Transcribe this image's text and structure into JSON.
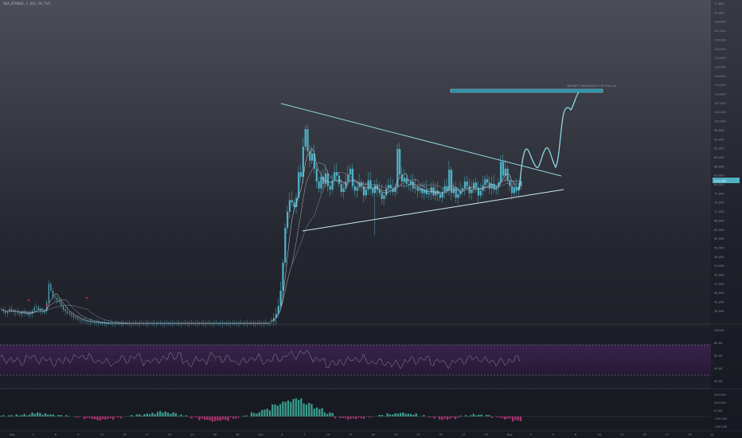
{
  "symbol": "SEA_STANDE, 1, KSC, FK, TV1",
  "target_label": "TARGET: 138,000.00 (+37.7%) n/a",
  "colors": {
    "background_top": "#4b4e57",
    "background_bottom": "#131722",
    "candle": "#4fb0c6",
    "trendline": "#8fd6e3",
    "target_box": "#2a8fa6",
    "rsi_line": "#9a9fa8",
    "rsi_band": "#5a3b78",
    "hist_up": "#3b9c8d",
    "hist_down": "#a8336e",
    "marker": "#c2185b"
  },
  "price_axis": [
    "77,800",
    "72,000",
    "136,000",
    "131,000",
    "128,000",
    "125,000",
    "122,000",
    "119,000",
    "116,000",
    "113,000",
    "110,000",
    "107,000",
    "104,000",
    "101,000",
    "98,000",
    "95,000",
    "92,000",
    "89,000",
    "86,000",
    "83,000",
    "80,000",
    "77,000",
    "74,000",
    "71,000",
    "68,000",
    "65,000",
    "62,000",
    "59,000",
    "56,000",
    "53,000",
    "50,000",
    "47,000",
    "44,000",
    "41,000",
    "38,000"
  ],
  "current_price": "101,000",
  "rsi_axis": [
    "100.00",
    "80.00",
    "60.00",
    "40.00",
    "20.00"
  ],
  "macd_axis": [
    "350.000",
    "200.000",
    "0.000",
    "-200.000",
    "-350.000"
  ],
  "time_axis": [
    "Sep",
    "3",
    "6",
    "9",
    "12",
    "15",
    "17",
    "20",
    "23",
    "26",
    "28",
    "Oct",
    "4",
    "7",
    "10",
    "13",
    "16",
    "19",
    "22",
    "25",
    "27",
    "29",
    "Nov",
    "3",
    "5",
    "8",
    "10",
    "12",
    "15",
    "17",
    "19",
    "21"
  ],
  "chart_data": {
    "type": "candlestick",
    "title": "",
    "xlabel": "",
    "ylabel": "",
    "x_range": [
      0,
      130
    ],
    "ylim": [
      38000,
      138000
    ],
    "grid": false,
    "legend": "none",
    "close": [
      44000,
      43200,
      42400,
      42900,
      44200,
      43600,
      42800,
      43100,
      42300,
      41800,
      42500,
      43000,
      42200,
      41600,
      42100,
      43400,
      44800,
      45100,
      44000,
      43200,
      42700,
      43300,
      47000,
      55000,
      52000,
      49500,
      49000,
      48000,
      47200,
      45500,
      44000,
      43200,
      42500,
      42000,
      41400,
      40800,
      40300,
      39800,
      39600,
      39300,
      39000,
      38800,
      38700,
      38600,
      38500,
      38400,
      38300,
      38200,
      38100,
      38000,
      38000,
      38000,
      38000,
      38000,
      38000,
      38000,
      38000,
      38000,
      38000,
      38000,
      38000,
      38000,
      38000,
      38000,
      38000,
      38000,
      38000,
      38000,
      38000,
      38000,
      38000,
      38000,
      38000,
      38000,
      38000,
      38000,
      38000,
      38000,
      38000,
      38000,
      38000,
      38000,
      38000,
      38000,
      38000,
      38000,
      38000,
      38000,
      38000,
      38000,
      38000,
      38000,
      38000,
      38000,
      38000,
      38000,
      38000,
      38000,
      38000,
      38000,
      38000,
      38000,
      38000,
      38000,
      38000,
      38000,
      38000,
      38000,
      38000,
      38000,
      38000,
      38000,
      38000,
      38000,
      38000,
      38000,
      38000,
      38000,
      38000,
      38000,
      38000,
      38000,
      38000,
      38000,
      38000,
      38000,
      38000,
      38000,
      38000,
      38000,
      38000
    ],
    "post_gap_close": [
      39000,
      40200,
      42000,
      45500,
      52000,
      64000,
      79000,
      86000,
      91000,
      90000,
      88000,
      92000,
      103000,
      101000,
      114000,
      121500,
      112000,
      108000,
      111000,
      104500,
      99000,
      96000,
      101000,
      98000,
      102500,
      97000,
      95500,
      99500,
      103000,
      101500,
      98000,
      94500,
      96000,
      99000,
      102000,
      104500,
      97000,
      95000,
      96500,
      98500,
      97000,
      93000,
      95500,
      99500,
      96000,
      94000,
      97500,
      95500,
      94000,
      91500,
      93000,
      96000,
      97500,
      96000,
      94500,
      96500,
      113000,
      102000,
      99000,
      100500,
      98000,
      97500,
      99000,
      96000,
      96500,
      95000,
      96000,
      94000,
      95500,
      93500,
      94000,
      96500,
      93000,
      95000,
      93500,
      92000,
      94500,
      97000,
      95000,
      104000,
      94000,
      96500,
      92000,
      93500,
      95000,
      96000,
      99000,
      97000,
      94000,
      95500,
      98500,
      96500,
      93000,
      95000,
      97500,
      100000,
      98500,
      96000,
      98000,
      95500,
      96500,
      98500,
      107500,
      101500,
      104500,
      99500,
      97000,
      94000,
      96500,
      95000,
      97000,
      99000
    ],
    "rsi": [
      52,
      48,
      55,
      50,
      46,
      53,
      58,
      49,
      44,
      51,
      56,
      47,
      53,
      60,
      45,
      50,
      57,
      52,
      46,
      54,
      49,
      55,
      61,
      64,
      50,
      42,
      48,
      53,
      47,
      45,
      41,
      49,
      52,
      47,
      43,
      50,
      54,
      48,
      45,
      51
    ],
    "macd_hist": [
      10,
      20,
      30,
      60,
      40,
      20,
      10,
      -10,
      -30,
      -60,
      -40,
      -20,
      10,
      30,
      50,
      80,
      60,
      20,
      -20,
      -50,
      -80,
      -60,
      -30,
      10,
      60,
      120,
      200,
      260,
      300,
      220,
      140,
      60,
      -20,
      -40,
      -30,
      -10,
      20,
      40,
      60,
      40,
      10,
      -20,
      -50,
      -30,
      10,
      30,
      20,
      -10,
      -40,
      -70
    ]
  },
  "target_path": "projected zig-zag to target"
}
